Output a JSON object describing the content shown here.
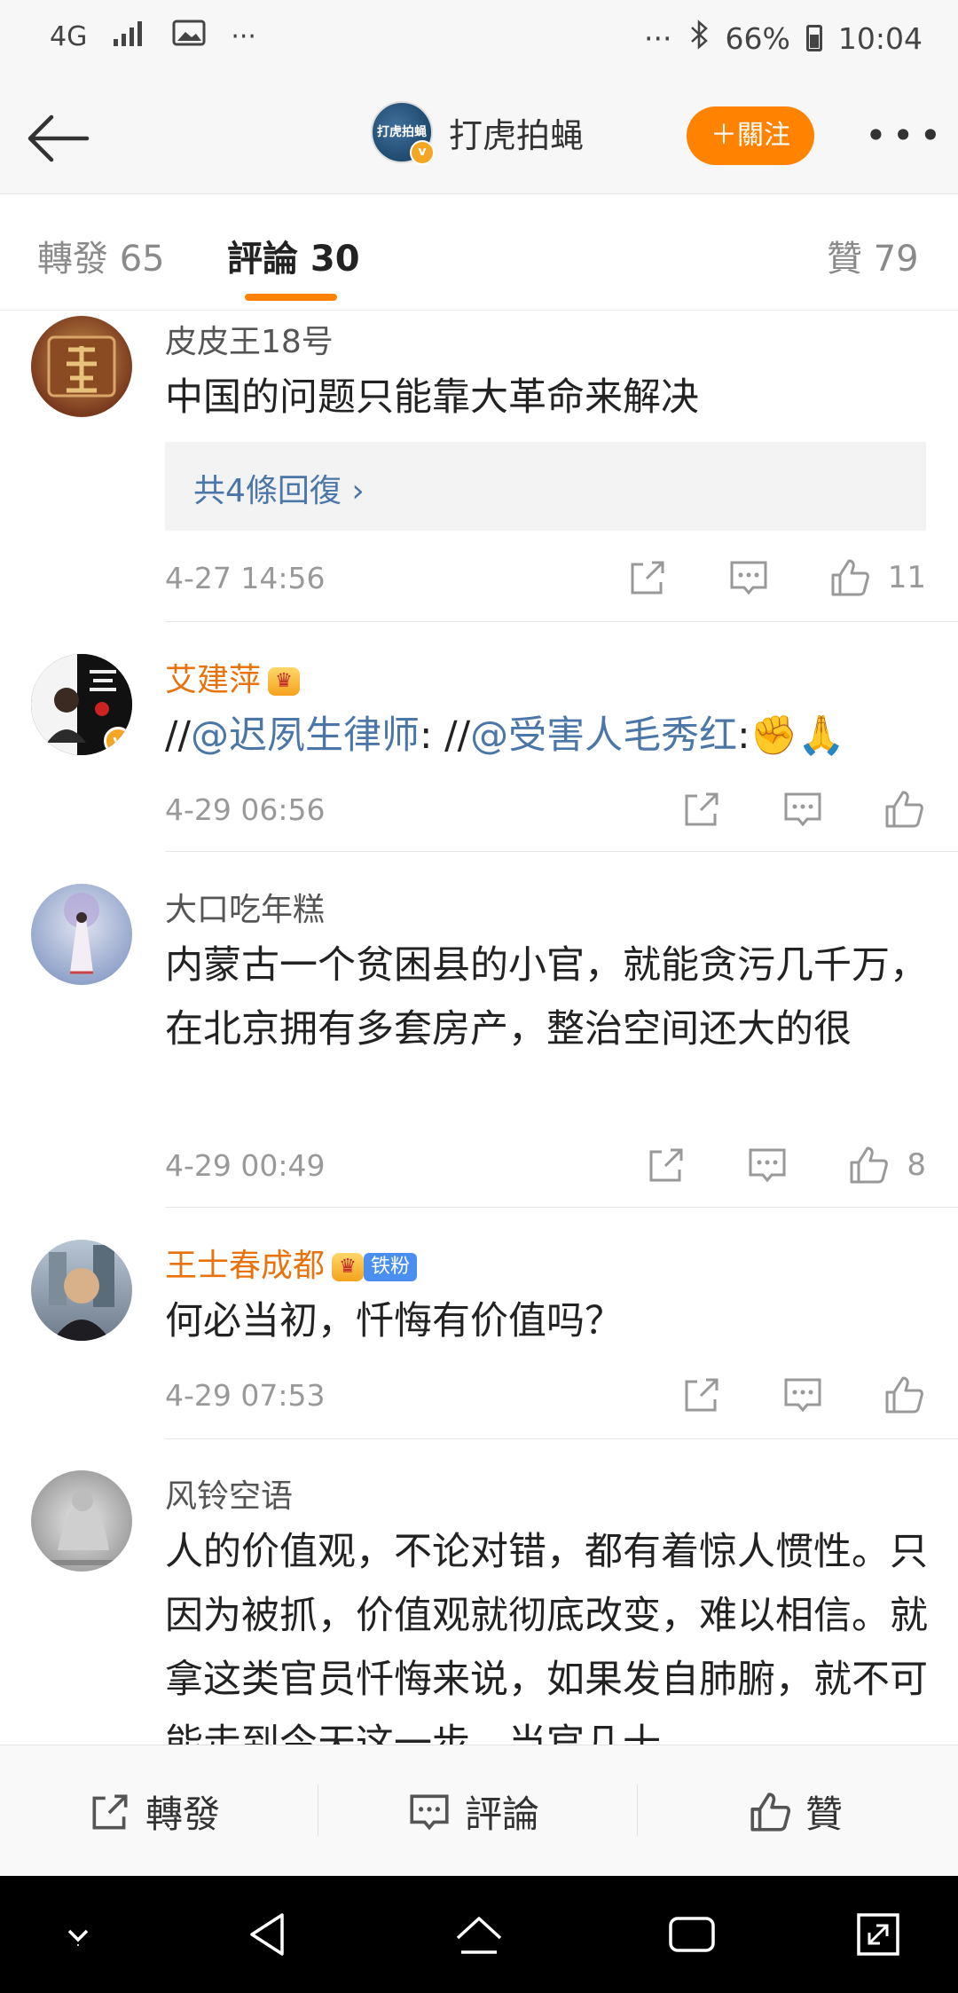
{
  "status_bar": {
    "network": "4G",
    "dots": "···",
    "right_dots": "···",
    "battery": "66%",
    "time": "10:04"
  },
  "header": {
    "account_logo_text": "打虎拍蝇",
    "account_name": "打虎拍蝇",
    "follow_label": "＋關注",
    "more": "•••"
  },
  "tabs": [
    {
      "label": "轉發 65"
    },
    {
      "label": "評論 30"
    },
    {
      "label": "贊 79"
    }
  ],
  "comments": [
    {
      "user": "皮皮王18号",
      "text": "中国的问题只能靠大革命来解决",
      "replies_label": "共4條回復 ›",
      "time": "4-27 14:56",
      "likes": "11"
    },
    {
      "user": "艾建萍",
      "text_parts": [
        "//",
        "@迟夙生律师",
        ": //",
        "@受害人毛秀红",
        ":✊🙏"
      ],
      "time": "4-29 06:56",
      "likes": ""
    },
    {
      "user": "大口吃年糕",
      "text": "内蒙古一个贫困县的小官，就能贪污几千万，在北京拥有多套房产，整治空间还大的很",
      "time": "4-29 00:49",
      "likes": "8"
    },
    {
      "user": "王士春成都",
      "fan_badge": "铁粉",
      "text": "何必当初，忏悔有价值吗？",
      "time": "4-29 07:53",
      "likes": ""
    },
    {
      "user": "风铃空语",
      "text": "人的价值观，不论对错，都有着惊人惯性。只因为被抓，价值观就彻底改变，难以相信。就拿这类官员忏悔来说，如果发自肺腑，就不可能走到今天这一步。当官几十"
    }
  ],
  "bottom_bar": {
    "repost": "轉發",
    "comment": "評論",
    "like": "贊"
  },
  "colors": {
    "accent": "#ff8200",
    "link": "#4b76a8",
    "vip_name": "#e8730c"
  }
}
